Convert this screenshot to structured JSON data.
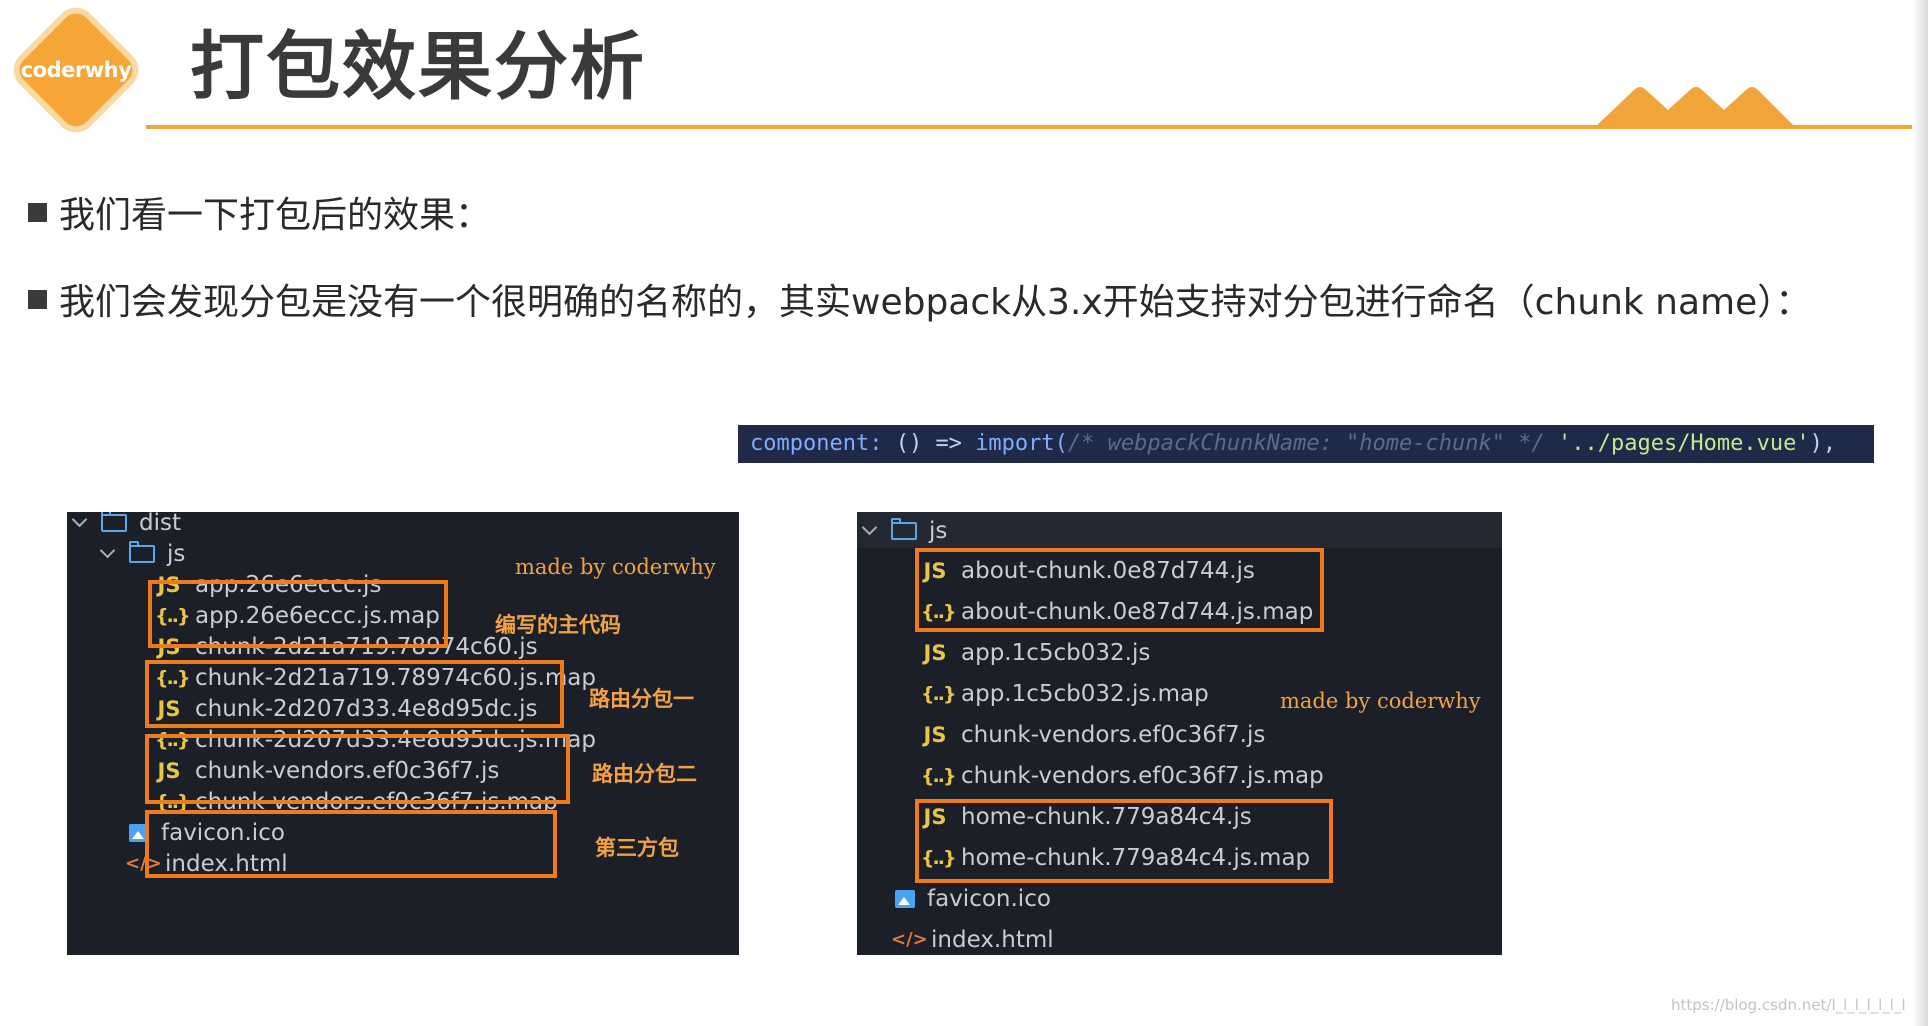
{
  "brand": {
    "logo_text": "coderwhy",
    "accent_color": "#f0a43a"
  },
  "slide": {
    "title": "打包效果分析"
  },
  "bullets": [
    "我们看一下打包后的效果：",
    "我们会发现分包是没有一个很明确的名称的，其实webpack从3.x开始支持对分包进行命名（chunk name）："
  ],
  "code": {
    "key": "component:",
    "arrow": "() =>",
    "call": "import(",
    "comment": "/* webpackChunkName: \"home-chunk\" */",
    "path": "'../pages/Home.vue'",
    "tail": "),"
  },
  "left_tree": {
    "root": "dist",
    "js_folder": "js",
    "files": [
      "app.26e6eccc.js",
      "app.26e6eccc.js.map",
      "chunk-2d21a719.78974c60.js",
      "chunk-2d21a719.78974c60.js.map",
      "chunk-2d207d33.4e8d95dc.js",
      "chunk-2d207d33.4e8d95dc.js.map",
      "chunk-vendors.ef0c36f7.js",
      "chunk-vendors.ef0c36f7.js.map",
      "favicon.ico",
      "index.html"
    ],
    "annotations": {
      "credit": "made by coderwhy",
      "main": "编写的主代码",
      "route1": "路由分包一",
      "route2": "路由分包二",
      "vendor": "第三方包"
    }
  },
  "right_tree": {
    "js_folder": "js",
    "files": [
      "about-chunk.0e87d744.js",
      "about-chunk.0e87d744.js.map",
      "app.1c5cb032.js",
      "app.1c5cb032.js.map",
      "chunk-vendors.ef0c36f7.js",
      "chunk-vendors.ef0c36f7.js.map",
      "home-chunk.779a84c4.js",
      "home-chunk.779a84c4.js.map",
      "favicon.ico",
      "index.html"
    ],
    "annotations": {
      "credit": "made by coderwhy"
    }
  },
  "icons": {
    "js": "JS",
    "map": "{..}",
    "html": "</>"
  },
  "watermark": "https://blog.csdn.net/l_l_l_l_l_l_l"
}
